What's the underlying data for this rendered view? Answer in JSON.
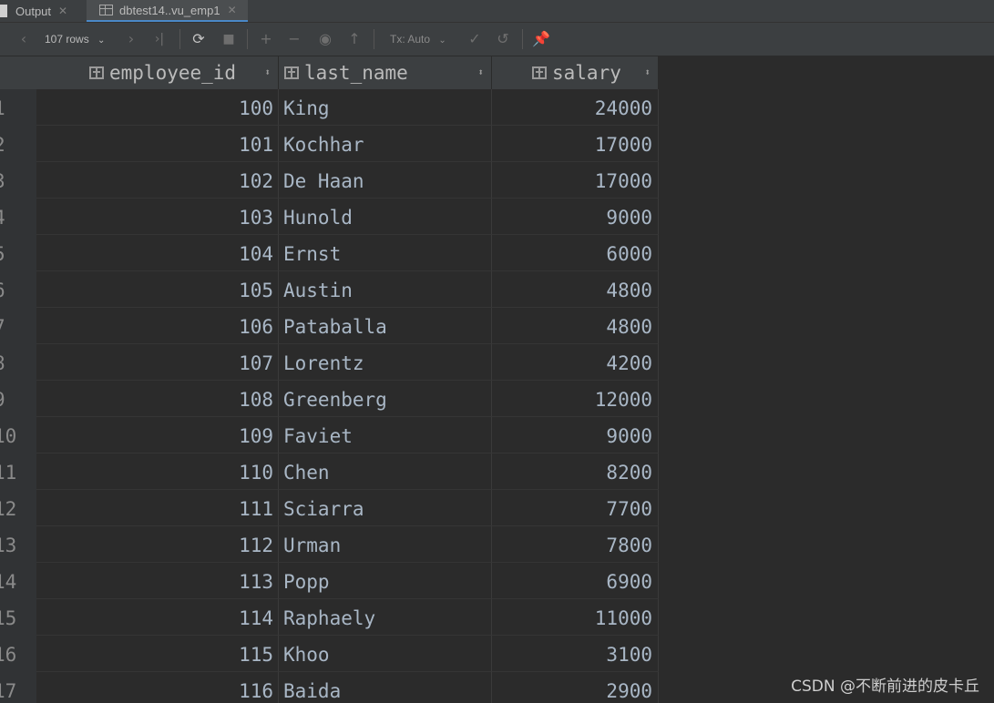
{
  "tabs": [
    {
      "label": "Output",
      "active": false
    },
    {
      "label": "dbtest14..vu_emp1",
      "active": true
    }
  ],
  "toolbar": {
    "row_count": "107 rows",
    "tx_mode": "Tx: Auto"
  },
  "columns": [
    {
      "name": "employee_id"
    },
    {
      "name": "last_name"
    },
    {
      "name": "salary"
    }
  ],
  "rows": [
    {
      "n": "1",
      "employee_id": "100",
      "last_name": "King",
      "salary": "24000"
    },
    {
      "n": "2",
      "employee_id": "101",
      "last_name": "Kochhar",
      "salary": "17000"
    },
    {
      "n": "3",
      "employee_id": "102",
      "last_name": "De Haan",
      "salary": "17000"
    },
    {
      "n": "4",
      "employee_id": "103",
      "last_name": "Hunold",
      "salary": "9000"
    },
    {
      "n": "5",
      "employee_id": "104",
      "last_name": "Ernst",
      "salary": "6000"
    },
    {
      "n": "6",
      "employee_id": "105",
      "last_name": "Austin",
      "salary": "4800"
    },
    {
      "n": "7",
      "employee_id": "106",
      "last_name": "Pataballa",
      "salary": "4800"
    },
    {
      "n": "8",
      "employee_id": "107",
      "last_name": "Lorentz",
      "salary": "4200"
    },
    {
      "n": "9",
      "employee_id": "108",
      "last_name": "Greenberg",
      "salary": "12000"
    },
    {
      "n": "10",
      "employee_id": "109",
      "last_name": "Faviet",
      "salary": "9000"
    },
    {
      "n": "11",
      "employee_id": "110",
      "last_name": "Chen",
      "salary": "8200"
    },
    {
      "n": "12",
      "employee_id": "111",
      "last_name": "Sciarra",
      "salary": "7700"
    },
    {
      "n": "13",
      "employee_id": "112",
      "last_name": "Urman",
      "salary": "7800"
    },
    {
      "n": "14",
      "employee_id": "113",
      "last_name": "Popp",
      "salary": "6900"
    },
    {
      "n": "15",
      "employee_id": "114",
      "last_name": "Raphaely",
      "salary": "11000"
    },
    {
      "n": "16",
      "employee_id": "115",
      "last_name": "Khoo",
      "salary": "3100"
    },
    {
      "n": "17",
      "employee_id": "116",
      "last_name": "Baida",
      "salary": "2900"
    }
  ],
  "watermark": "CSDN @不断前进的皮卡丘"
}
